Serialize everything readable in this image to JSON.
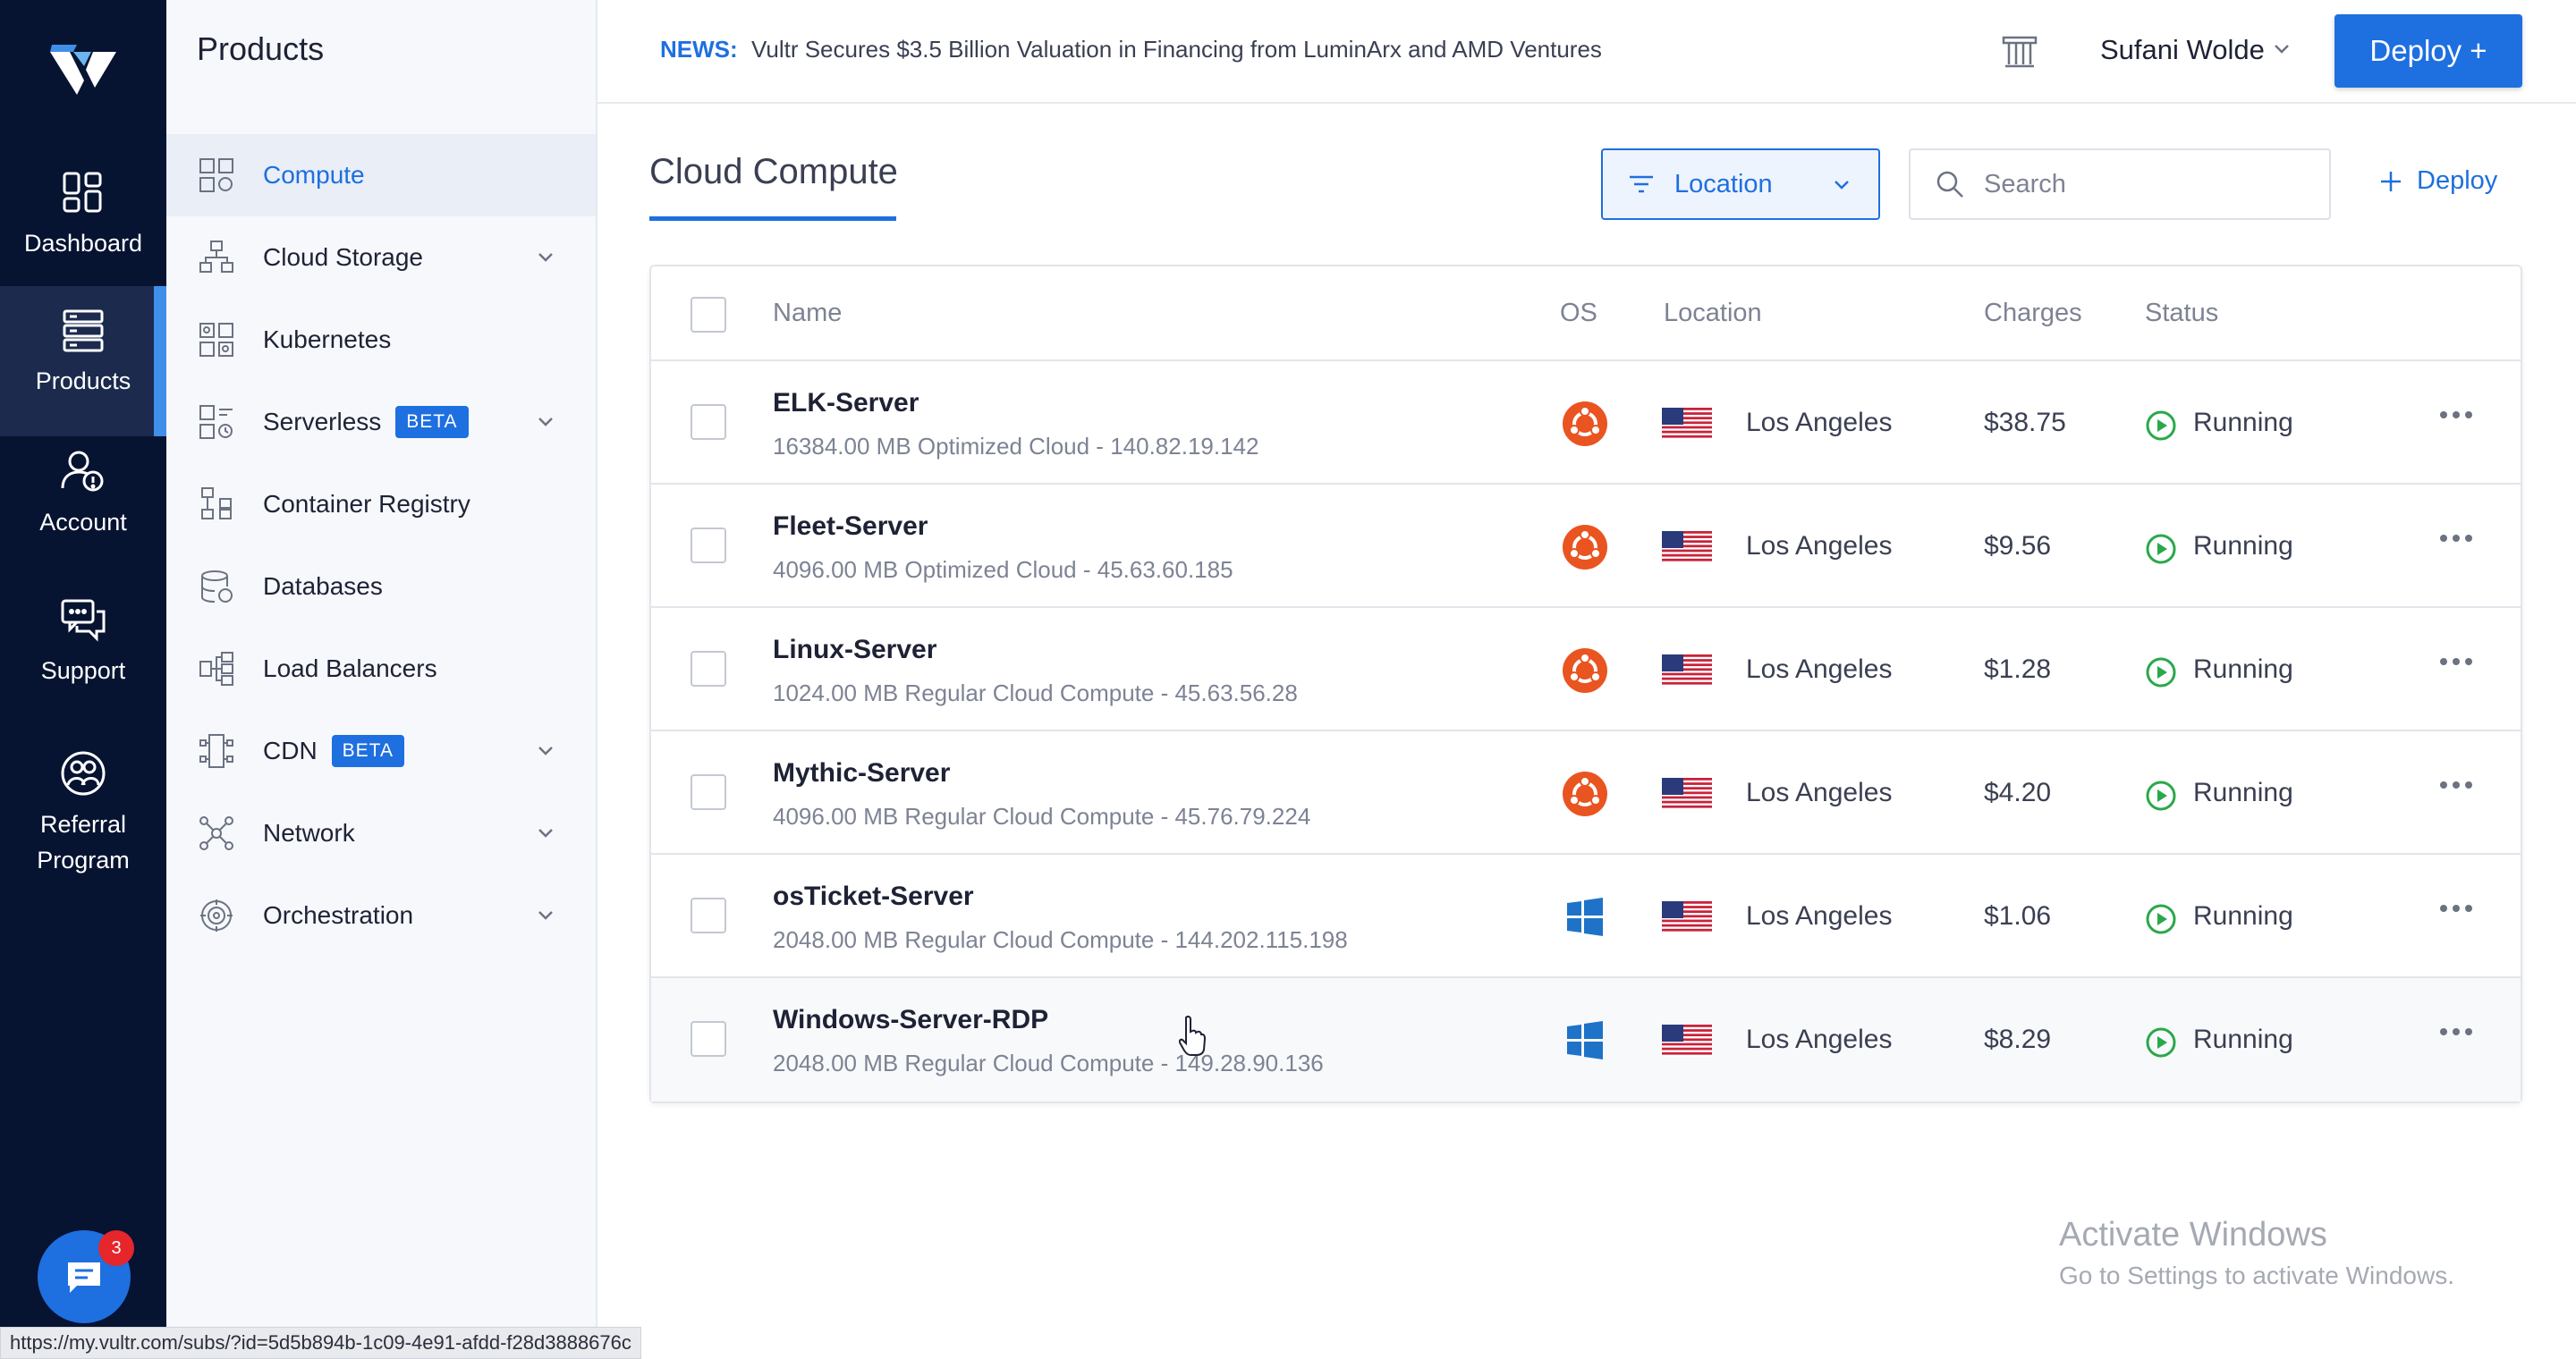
{
  "rail": {
    "items": [
      {
        "label": "Dashboard"
      },
      {
        "label": "Products"
      },
      {
        "label": "Account"
      },
      {
        "label": "Support"
      },
      {
        "label": "Referral Program"
      }
    ],
    "chat_badge": "3"
  },
  "sidebar": {
    "title": "Products",
    "items": [
      {
        "label": "Compute",
        "icon": "compute-icon"
      },
      {
        "label": "Cloud Storage",
        "icon": "storage-icon"
      },
      {
        "label": "Kubernetes",
        "icon": "kubernetes-icon"
      },
      {
        "label": "Serverless",
        "icon": "serverless-icon",
        "badge": "BETA"
      },
      {
        "label": "Container Registry",
        "icon": "registry-icon"
      },
      {
        "label": "Databases",
        "icon": "database-icon"
      },
      {
        "label": "Load Balancers",
        "icon": "load-balancer-icon"
      },
      {
        "label": "CDN",
        "icon": "cdn-icon",
        "badge": "BETA"
      },
      {
        "label": "Network",
        "icon": "network-icon"
      },
      {
        "label": "Orchestration",
        "icon": "orchestration-icon"
      }
    ]
  },
  "topbar": {
    "news_label": "NEWS:",
    "news_text": "Vultr Secures $3.5 Billion Valuation in Financing from LuminArx and AMD Ventures",
    "user_name": "Sufani Wolde",
    "deploy_label": "Deploy +"
  },
  "main": {
    "title": "Cloud Compute",
    "location_filter": "Location",
    "search_placeholder": "Search",
    "deploy_link": "Deploy"
  },
  "table": {
    "headers": {
      "name": "Name",
      "os": "OS",
      "location": "Location",
      "charges": "Charges",
      "status": "Status"
    },
    "rows": [
      {
        "name": "ELK-Server",
        "desc": "16384.00 MB Optimized Cloud - 140.82.19.142",
        "os": "ubuntu",
        "location": "Los Angeles",
        "charges": "$38.75",
        "status": "Running"
      },
      {
        "name": "Fleet-Server",
        "desc": "4096.00 MB Optimized Cloud - 45.63.60.185",
        "os": "ubuntu",
        "location": "Los Angeles",
        "charges": "$9.56",
        "status": "Running"
      },
      {
        "name": "Linux-Server",
        "desc": "1024.00 MB Regular Cloud Compute - 45.63.56.28",
        "os": "ubuntu",
        "location": "Los Angeles",
        "charges": "$1.28",
        "status": "Running"
      },
      {
        "name": "Mythic-Server",
        "desc": "4096.00 MB Regular Cloud Compute - 45.76.79.224",
        "os": "ubuntu",
        "location": "Los Angeles",
        "charges": "$4.20",
        "status": "Running"
      },
      {
        "name": "osTicket-Server",
        "desc": "2048.00 MB Regular Cloud Compute - 144.202.115.198",
        "os": "windows",
        "location": "Los Angeles",
        "charges": "$1.06",
        "status": "Running"
      },
      {
        "name": "Windows-Server-RDP",
        "desc": "2048.00 MB Regular Cloud Compute - 149.28.90.136",
        "os": "windows",
        "location": "Los Angeles",
        "charges": "$8.29",
        "status": "Running"
      }
    ]
  },
  "watermark": {
    "line1": "Activate Windows",
    "line2": "Go to Settings to activate Windows."
  },
  "statusbar": {
    "url": "https://my.vultr.com/subs/?id=5d5b894b-1c09-4e91-afdd-f28d3888676c"
  },
  "colors": {
    "accent": "#1e6fe0",
    "rail": "#061331",
    "ubuntu": "#e95420",
    "windows": "#1e73c8",
    "running": "#2aa84a"
  }
}
